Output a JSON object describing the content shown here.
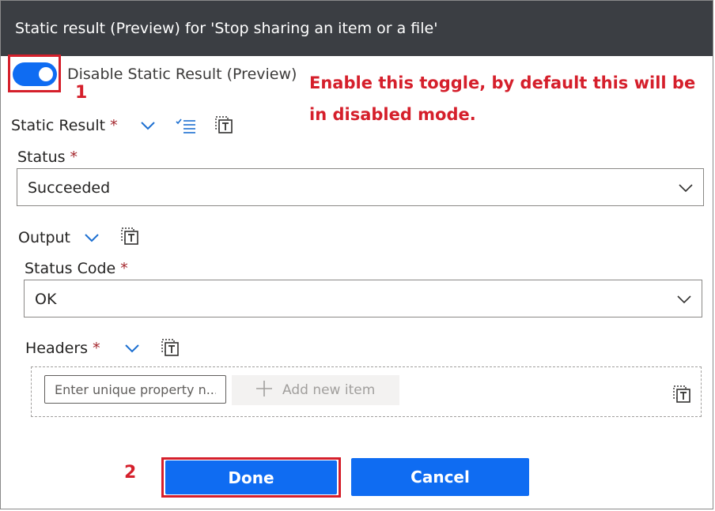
{
  "dialog": {
    "title": "Static result (Preview) for 'Stop sharing an item or a file'"
  },
  "toggle": {
    "label": "Disable Static Result (Preview)",
    "on": true,
    "accent": "#0f6cf2"
  },
  "annotations": {
    "text": "Enable this toggle, by default this will be in disabled mode.",
    "step1": "1",
    "step2": "2",
    "color": "#d51f2b"
  },
  "static_result": {
    "label": "Static Result",
    "required": "*",
    "icons": [
      "chevron-down-icon",
      "checklist-icon",
      "text-token-icon"
    ]
  },
  "status": {
    "label": "Status",
    "required": "*",
    "value": "Succeeded"
  },
  "output": {
    "label": "Output",
    "icons": [
      "chevron-down-icon",
      "text-token-icon"
    ]
  },
  "status_code": {
    "label": "Status Code",
    "required": "*",
    "value": "OK"
  },
  "headers": {
    "label": "Headers",
    "required": "*",
    "input_placeholder": "Enter unique property n...",
    "add_label": "Add new item"
  },
  "buttons": {
    "done": "Done",
    "cancel": "Cancel"
  }
}
